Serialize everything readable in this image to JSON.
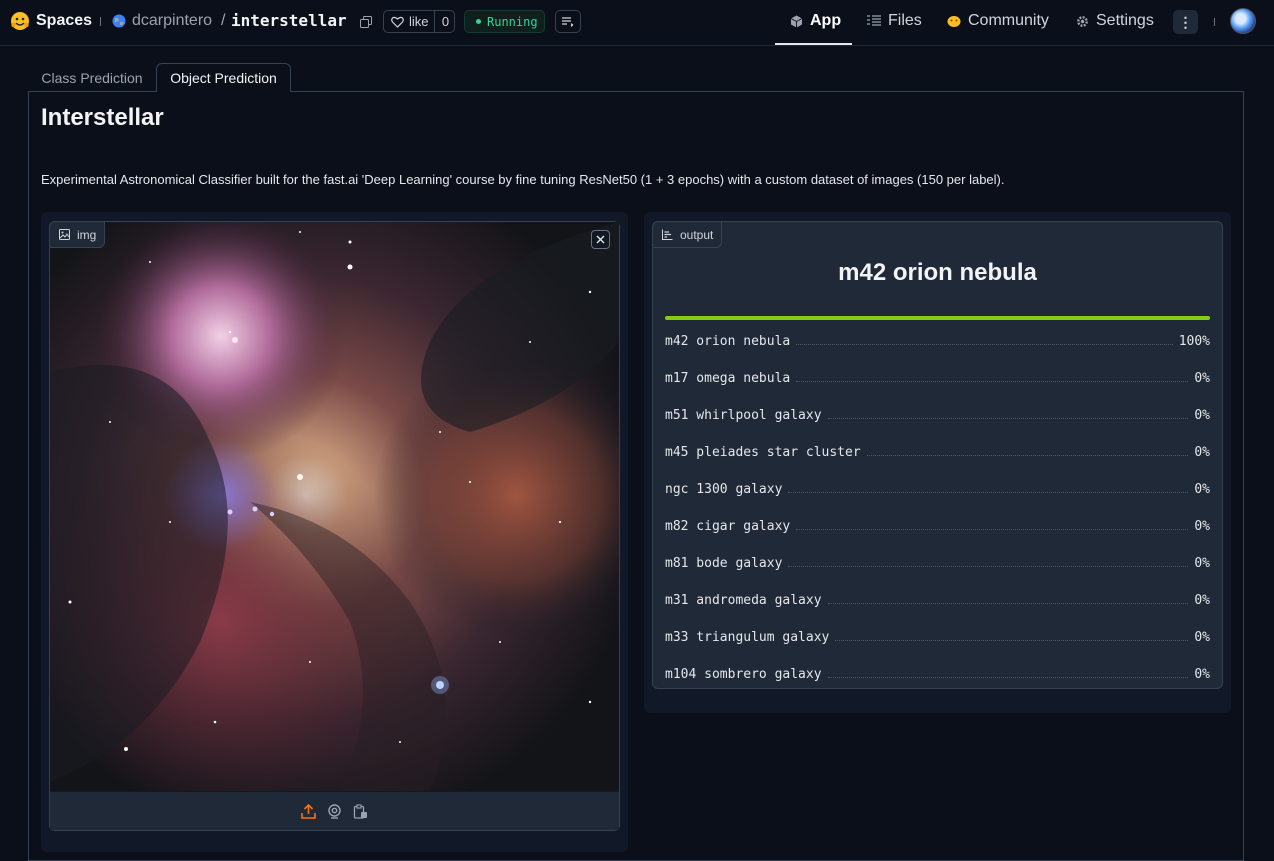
{
  "header": {
    "brand": "Spaces",
    "owner": "dcarpintero",
    "slash": "/",
    "repo": "interstellar",
    "like_label": "like",
    "like_count": "0",
    "status": "Running",
    "nav": {
      "app": "App",
      "files": "Files",
      "community": "Community",
      "settings": "Settings"
    },
    "more": "⋮"
  },
  "tabs": [
    {
      "label": "Class Prediction",
      "selected": false
    },
    {
      "label": "Object Prediction",
      "selected": true
    }
  ],
  "main": {
    "title": "Interstellar",
    "description": "Experimental Astronomical Classifier built for the fast.ai 'Deep Learning' course by fine tuning ResNet50 (1 + 3 epochs) with a custom dataset of images (150 per label)."
  },
  "input": {
    "label": "img",
    "icon": "image-icon",
    "image_content": "Orion Nebula astronomical photo"
  },
  "output": {
    "label": "output",
    "icon": "label-icon",
    "top_prediction": "m42 orion nebula",
    "top_confidence": 1.0,
    "confidences": [
      {
        "label": "m42 orion nebula",
        "pct": "100%"
      },
      {
        "label": "m17 omega nebula",
        "pct": "0%"
      },
      {
        "label": "m51 whirlpool galaxy",
        "pct": "0%"
      },
      {
        "label": "m45 pleiades star cluster",
        "pct": "0%"
      },
      {
        "label": "ngc 1300 galaxy",
        "pct": "0%"
      },
      {
        "label": "m82 cigar galaxy",
        "pct": "0%"
      },
      {
        "label": "m81 bode galaxy",
        "pct": "0%"
      },
      {
        "label": "m31 andromeda galaxy",
        "pct": "0%"
      },
      {
        "label": "m33 triangulum galaxy",
        "pct": "0%"
      },
      {
        "label": "m104 sombrero galaxy",
        "pct": "0%"
      }
    ]
  },
  "colors": {
    "background": "#0b0f19",
    "status_green": "#34d399",
    "bar_fill": "#84cc16",
    "tool_accent": "#f97316"
  }
}
